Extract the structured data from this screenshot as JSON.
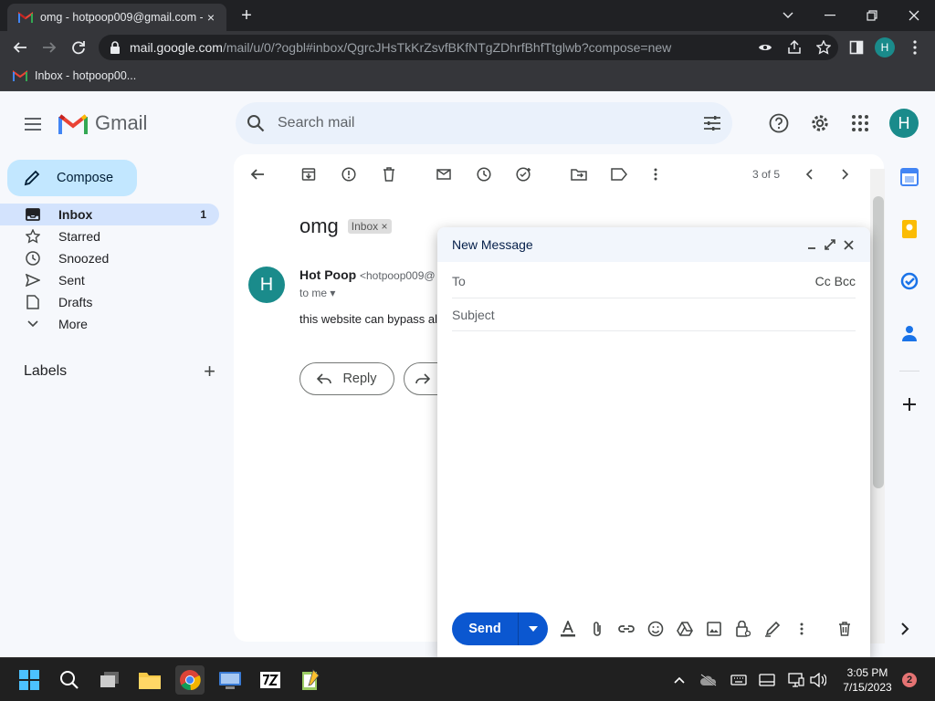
{
  "browser": {
    "tab_title": "omg - hotpoop009@gmail.com -",
    "tab_close": "×",
    "new_tab": "+",
    "url_host": "mail.google.com",
    "url_path": "/mail/u/0/?ogbl#inbox/QgrcJHsTkKrZsvfBKfNTgZDhrfBhfTtglwb?compose=new",
    "profile_initial": "H",
    "bookmark_label": "Inbox - hotpoop00..."
  },
  "gmail": {
    "brand": "Gmail",
    "search_placeholder": "Search mail",
    "avatar_initial": "H",
    "compose_label": "Compose",
    "nav": [
      {
        "label": "Inbox",
        "count": "1"
      },
      {
        "label": "Starred",
        "count": ""
      },
      {
        "label": "Snoozed",
        "count": ""
      },
      {
        "label": "Sent",
        "count": ""
      },
      {
        "label": "Drafts",
        "count": ""
      },
      {
        "label": "More",
        "count": ""
      }
    ],
    "labels_title": "Labels",
    "labels_add": "+"
  },
  "message": {
    "pager": "3 of 5",
    "subject": "omg",
    "label_chip": "Inbox ×",
    "sender_initial": "H",
    "sender_name": "Hot Poop",
    "sender_email": "<hotpoop009@",
    "to_me": "to me ▾",
    "snippet": "this website can bypass al",
    "reply_label": "Reply"
  },
  "compose_dialog": {
    "title": "New Message",
    "to_label": "To",
    "to_value": "",
    "cc_bcc": "Cc Bcc",
    "subject_placeholder": "Subject",
    "send_label": "Send"
  },
  "taskbar": {
    "time": "3:05 PM",
    "date": "7/15/2023",
    "notifications": "2"
  },
  "colors": {
    "accent": "#0b57d0",
    "avatar": "#1a8b8b",
    "compose_bg": "#c2e7ff",
    "active_nav": "#d3e3fd",
    "chrome_dark": "#202124"
  }
}
